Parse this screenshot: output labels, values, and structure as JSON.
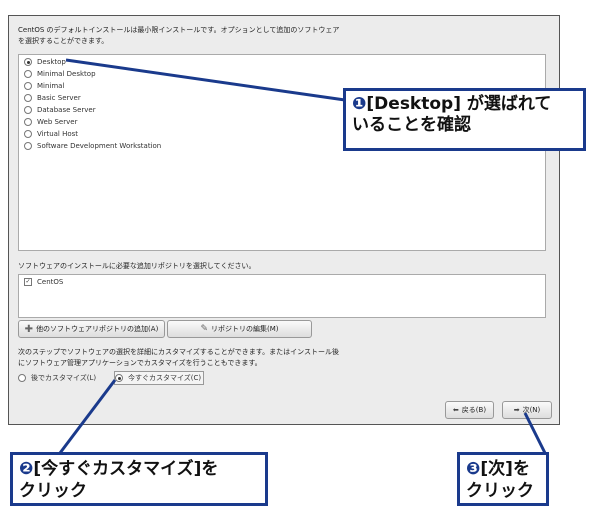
{
  "intro_text": [
    "CentOS のデフォルトインストールは最小限インストールです。オプションとして追加のソフトウェア",
    "を選択することができます。"
  ],
  "install_options": [
    {
      "label": "Desktop",
      "selected": true
    },
    {
      "label": "Minimal Desktop",
      "selected": false
    },
    {
      "label": "Minimal",
      "selected": false
    },
    {
      "label": "Basic Server",
      "selected": false
    },
    {
      "label": "Database Server",
      "selected": false
    },
    {
      "label": "Web Server",
      "selected": false
    },
    {
      "label": "Virtual Host",
      "selected": false
    },
    {
      "label": "Software Development Workstation",
      "selected": false
    }
  ],
  "repo_label": "ソフトウェアのインストールに必要な追加リポジトリを選択してください。",
  "repos": [
    {
      "label": "CentOS",
      "checked": true
    }
  ],
  "add_repo_button": "他のソフトウェアリポジトリの追加(A)",
  "edit_repo_button": "リポジトリの編集(M)",
  "customize_text": [
    "次のステップでソフトウェアの選択を詳細にカスタマイズすることができます。またはインストール後",
    "にソフトウェア管理アプリケーションでカスタマイズを行うこともできます。"
  ],
  "customize_later": "後でカスタマイズ(L)",
  "customize_now": "今すぐカスタマイズ(C)",
  "back_button": "戻る(B)",
  "next_button": "次(N)",
  "callouts": {
    "c1": {
      "num": "❶",
      "text1": "[Desktop] が選ばれて",
      "text2": "いることを確認"
    },
    "c2": {
      "num": "❷",
      "text1": "[今すぐカスタマイズ]を",
      "text2": "クリック"
    },
    "c3": {
      "num": "❸",
      "text1": "[次]を",
      "text2": "クリック"
    }
  },
  "accent_color": "#1a3a8c"
}
